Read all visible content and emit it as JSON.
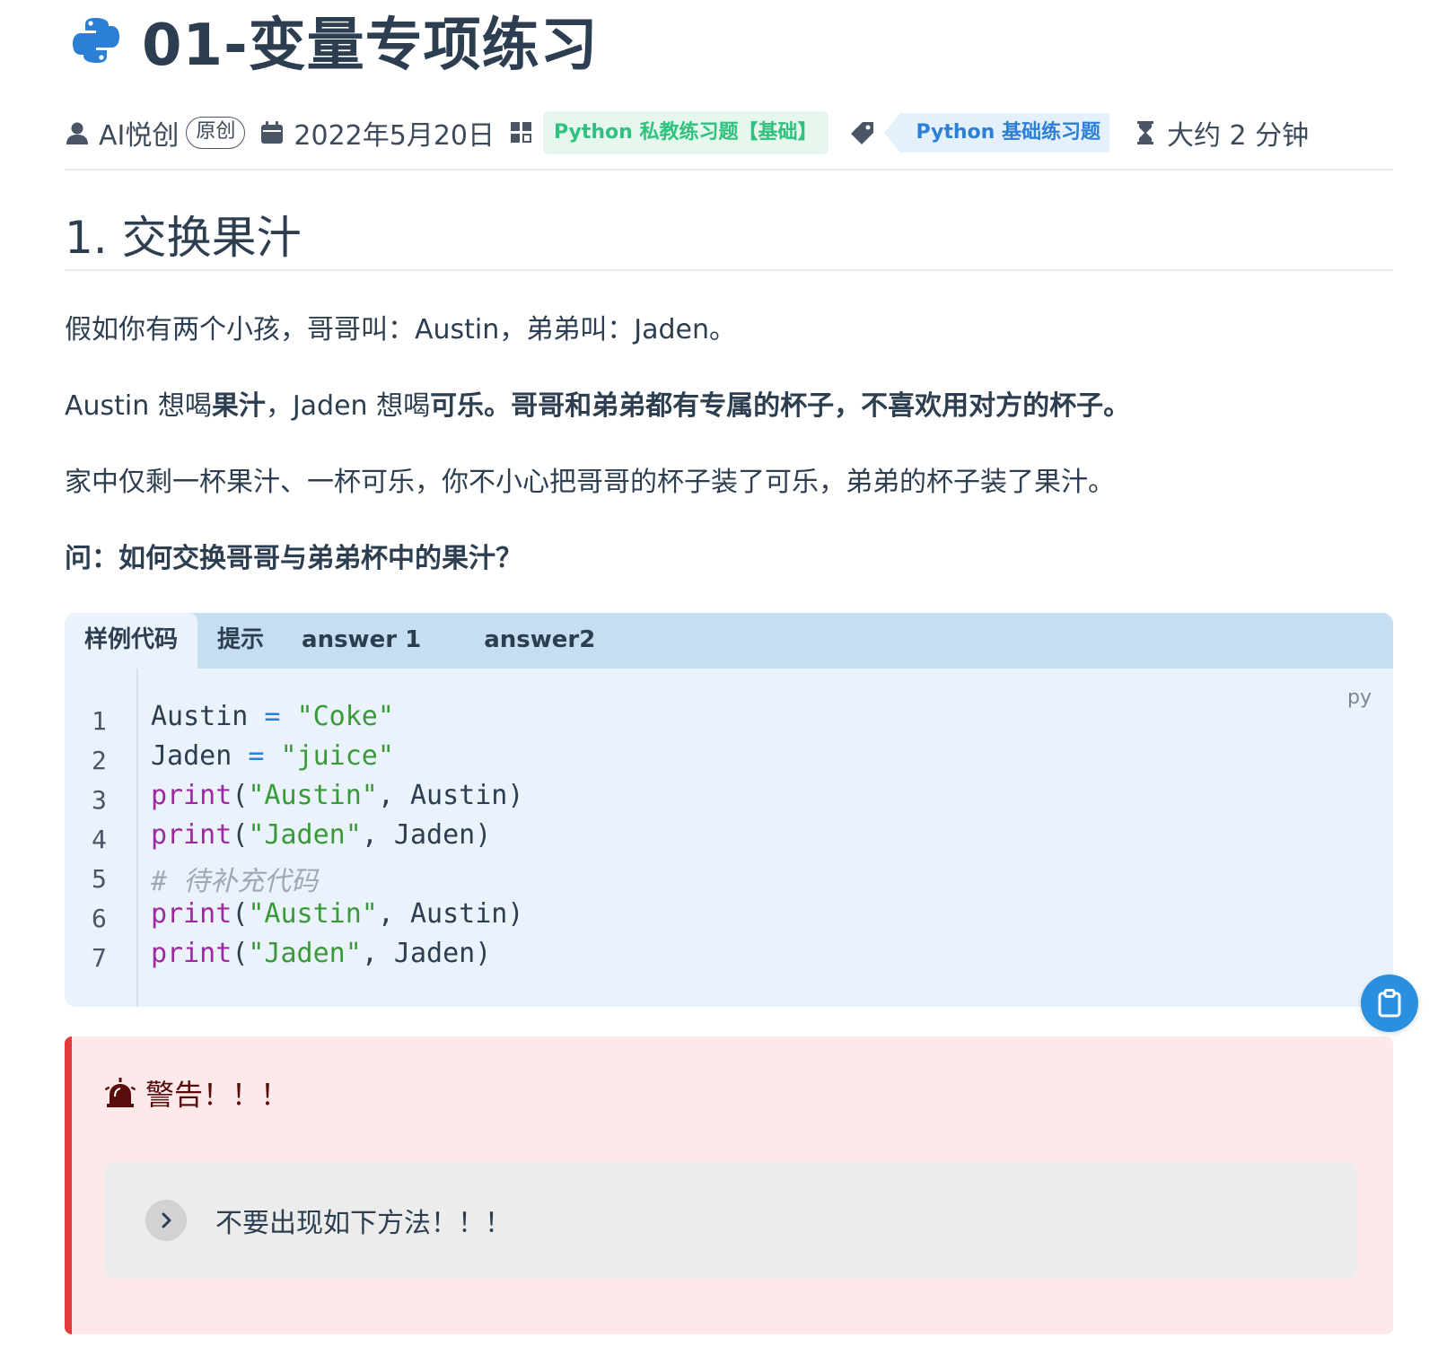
{
  "page": {
    "title": "01-变量专项练习"
  },
  "meta": {
    "author": "AI悦创",
    "original_badge": "原创",
    "date": "2022年5月20日",
    "category": "Python 私教练习题【基础】",
    "tag": "Python 基础练习题",
    "reading_time": "大约 2 分钟"
  },
  "section": {
    "heading": "1. 交换果汁",
    "p1": "假如你有两个小孩，哥哥叫：Austin，弟弟叫：Jaden。",
    "p2_a": "Austin 想喝",
    "p2_b": "果汁",
    "p2_c": "，Jaden 想喝",
    "p2_d": "可乐。哥哥和弟弟都有专属的杯子，不喜欢用对方的杯子。",
    "p3": "家中仅剩一杯果汁、一杯可乐，你不小心把哥哥的杯子装了可乐，弟弟的杯子装了果汁。",
    "question": "问：如何交换哥哥与弟弟杯中的果汁？"
  },
  "code_tabs": {
    "tabs": [
      "样例代码",
      "提示",
      "answer 1",
      "answer2"
    ],
    "active_index": 0,
    "language": "py",
    "line_numbers": [
      "1",
      "2",
      "3",
      "4",
      "5",
      "6",
      "7"
    ],
    "lines": [
      {
        "a": "Austin",
        "b": " = ",
        "c": "\"Coke\""
      },
      {
        "a": "Jaden",
        "b": " = ",
        "c": "\"juice\""
      },
      {
        "kw": "print",
        "p1": "(",
        "s": "\"Austin\"",
        "rest": ", Austin)"
      },
      {
        "kw": "print",
        "p1": "(",
        "s": "\"Jaden\"",
        "rest": ", Jaden)"
      },
      {
        "comment": "# 待补充代码"
      },
      {
        "kw": "print",
        "p1": "(",
        "s": "\"Austin\"",
        "rest": ", Austin)"
      },
      {
        "kw": "print",
        "p1": "(",
        "s": "\"Jaden\"",
        "rest": ", Jaden)"
      }
    ]
  },
  "warning": {
    "title": "警告！！！",
    "details_summary": "不要出现如下方法！！！"
  },
  "icons": {
    "logo": "python-logo-icon",
    "author": "user-icon",
    "date": "calendar-icon",
    "category": "category-icon",
    "tag": "tag-icon",
    "time": "hourglass-icon",
    "copy": "clipboard-icon",
    "alarm": "alarm-icon",
    "chevron": "chevron-right-icon"
  },
  "colors": {
    "category_text": "#2ec27e",
    "tag_text": "#2b7fd6",
    "warning_border": "#e33a3a",
    "copy_button": "#2b8fe0"
  }
}
